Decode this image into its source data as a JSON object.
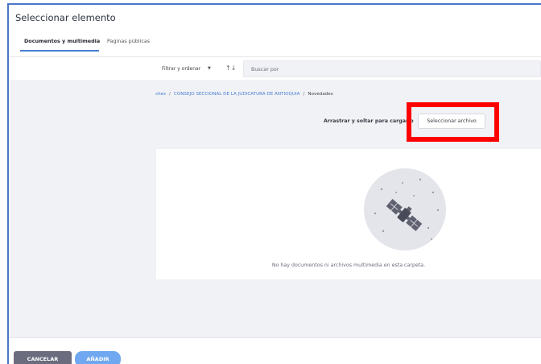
{
  "dialog": {
    "title": "Seleccionar elemento"
  },
  "tabs": [
    {
      "label": "Documentos y multimedia"
    },
    {
      "label": "Paginas públicas"
    }
  ],
  "toolbar": {
    "filter_label": "Filtrar y ordenar",
    "filter_caret": "▼",
    "sort_glyph": "↑↓",
    "search_placeholder": "Buscar por"
  },
  "breadcrumb": {
    "items": [
      "sites",
      "CONSEJO SECCIONAL DE LA JUDICATURA DE ANTIOQUIA",
      "Novedades"
    ],
    "separator": "/"
  },
  "upload": {
    "drop_label": "Arrastrar y soltar para cargar o",
    "select_button": "Seleccionar archivo"
  },
  "empty_state": {
    "message": "No hay documentos ni archivos multimedia en esta carpeta.",
    "illustration_icon": "satellite-icon"
  },
  "footer": {
    "cancel": "CANCELAR",
    "add": "AÑADIR"
  },
  "colors": {
    "accent": "#4a7fd4",
    "frame": "#4a76c7",
    "highlight": "#ff0000",
    "cancel_bg": "#6b6c7e",
    "add_bg": "#6fa8f0"
  }
}
